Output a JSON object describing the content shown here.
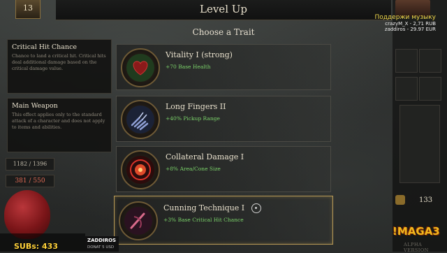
{
  "header": {
    "title": "Level Up",
    "level": "13"
  },
  "panel_title": "Choose a Trait",
  "tooltips": [
    {
      "title": "Critical Hit Chance",
      "desc": "Chance to land a critical hit. Critical hits deal additional damage based on the critical damage value."
    },
    {
      "title": "Main Weapon",
      "desc": "This effect applies only to the standard attack of a character and does not apply to items and abilities."
    }
  ],
  "traits": [
    {
      "name": "Vitality I (strong)",
      "bonus": "+70 Base Health",
      "icon": "heart-icon"
    },
    {
      "name": "Long Fingers II",
      "bonus": "+40% Pickup Range",
      "icon": "claw-hand-icon"
    },
    {
      "name": "Collateral Damage I",
      "bonus": "+8% Area/Cone Size",
      "icon": "explosion-icon"
    },
    {
      "name": "Cunning Technique I",
      "bonus": "+3% Base Critical Hit Chance",
      "icon": "dagger-strike-icon"
    }
  ],
  "stats": {
    "xp": "1182 / 1396",
    "health": "381 / 550"
  },
  "gold": "133",
  "stream": {
    "title": "Поддержи музыку",
    "line2": "crazyM_X - 2,71 RUB",
    "line3": "zaddiros - 29.97 EUR",
    "subs": "SUBs: 433",
    "donor": "ZADDIROS",
    "donor_amount": "DONAT 5 USD",
    "brand": "!MAGA3",
    "alpha": "ALPHA VERSION"
  },
  "colors": {
    "bonus": "#7bd36a",
    "selected_border": "#b99a56",
    "health": "#e06a55"
  }
}
